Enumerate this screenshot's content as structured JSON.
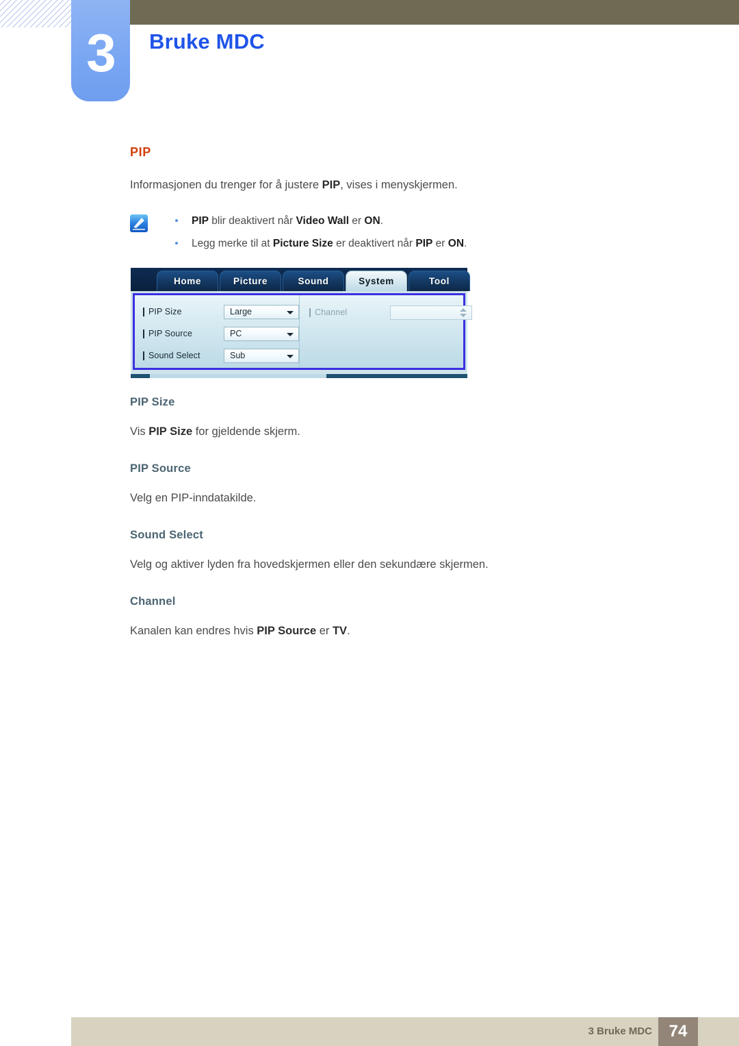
{
  "header": {
    "chapter_number": "3",
    "chapter_title": "Bruke MDC",
    "accent_blue": "#1f54e8",
    "bar_olive": "#6e6a54",
    "chapter_box_blue": "#7aa7f2"
  },
  "section": {
    "title": "PIP",
    "title_color": "#d2400c",
    "intro_pre": "Informasjonen du trenger for å justere ",
    "intro_bold": "PIP",
    "intro_post": ", vises i menyskjermen."
  },
  "note": {
    "icon": "note-pencil-icon",
    "items": [
      {
        "b1": "PIP",
        "t1": " blir deaktivert når ",
        "b2": "Video Wall",
        "t2": " er ",
        "b3": "ON",
        "t3": "."
      },
      {
        "b1": "",
        "t1": "Legg merke til at ",
        "b2": "Picture Size",
        "t2": " er deaktivert når ",
        "b3": "PIP",
        "t3": " er ",
        "b4": "ON",
        "t4": "."
      }
    ]
  },
  "dialog": {
    "tabs": [
      {
        "label": "Home",
        "active": false
      },
      {
        "label": "Picture",
        "active": false
      },
      {
        "label": "Sound",
        "active": false
      },
      {
        "label": "System",
        "active": true
      },
      {
        "label": "Tool",
        "active": false
      }
    ],
    "left_fields": [
      {
        "label": "PIP Size",
        "value": "Large",
        "control": "dropdown",
        "disabled": false
      },
      {
        "label": "PIP Source",
        "value": "PC",
        "control": "dropdown",
        "disabled": false
      },
      {
        "label": "Sound Select",
        "value": "Sub",
        "control": "dropdown",
        "disabled": false
      }
    ],
    "right_fields": [
      {
        "label": "Channel",
        "value": "",
        "control": "spinner",
        "disabled": true
      }
    ],
    "focus_border_color": "#3b2fe0"
  },
  "subsections": [
    {
      "heading": "PIP Size",
      "pre": "Vis ",
      "bold": "PIP Size",
      "post": " for gjeldende skjerm."
    },
    {
      "heading": "PIP Source",
      "pre": "Velg en PIP-inndatakilde.",
      "bold": "",
      "post": ""
    },
    {
      "heading": "Sound Select",
      "pre": "Velg og aktiver lyden fra hovedskjermen eller den sekundære skjermen.",
      "bold": "",
      "post": ""
    },
    {
      "heading": "Channel",
      "pre": "Kanalen kan endres hvis ",
      "bold": "PIP Source",
      "post": " er ",
      "bold2": "TV",
      "post2": "."
    }
  ],
  "footer": {
    "label": "3 Bruke MDC",
    "page_number": "74",
    "bar_color": "#d8d3c0",
    "page_box_color": "#938678"
  }
}
